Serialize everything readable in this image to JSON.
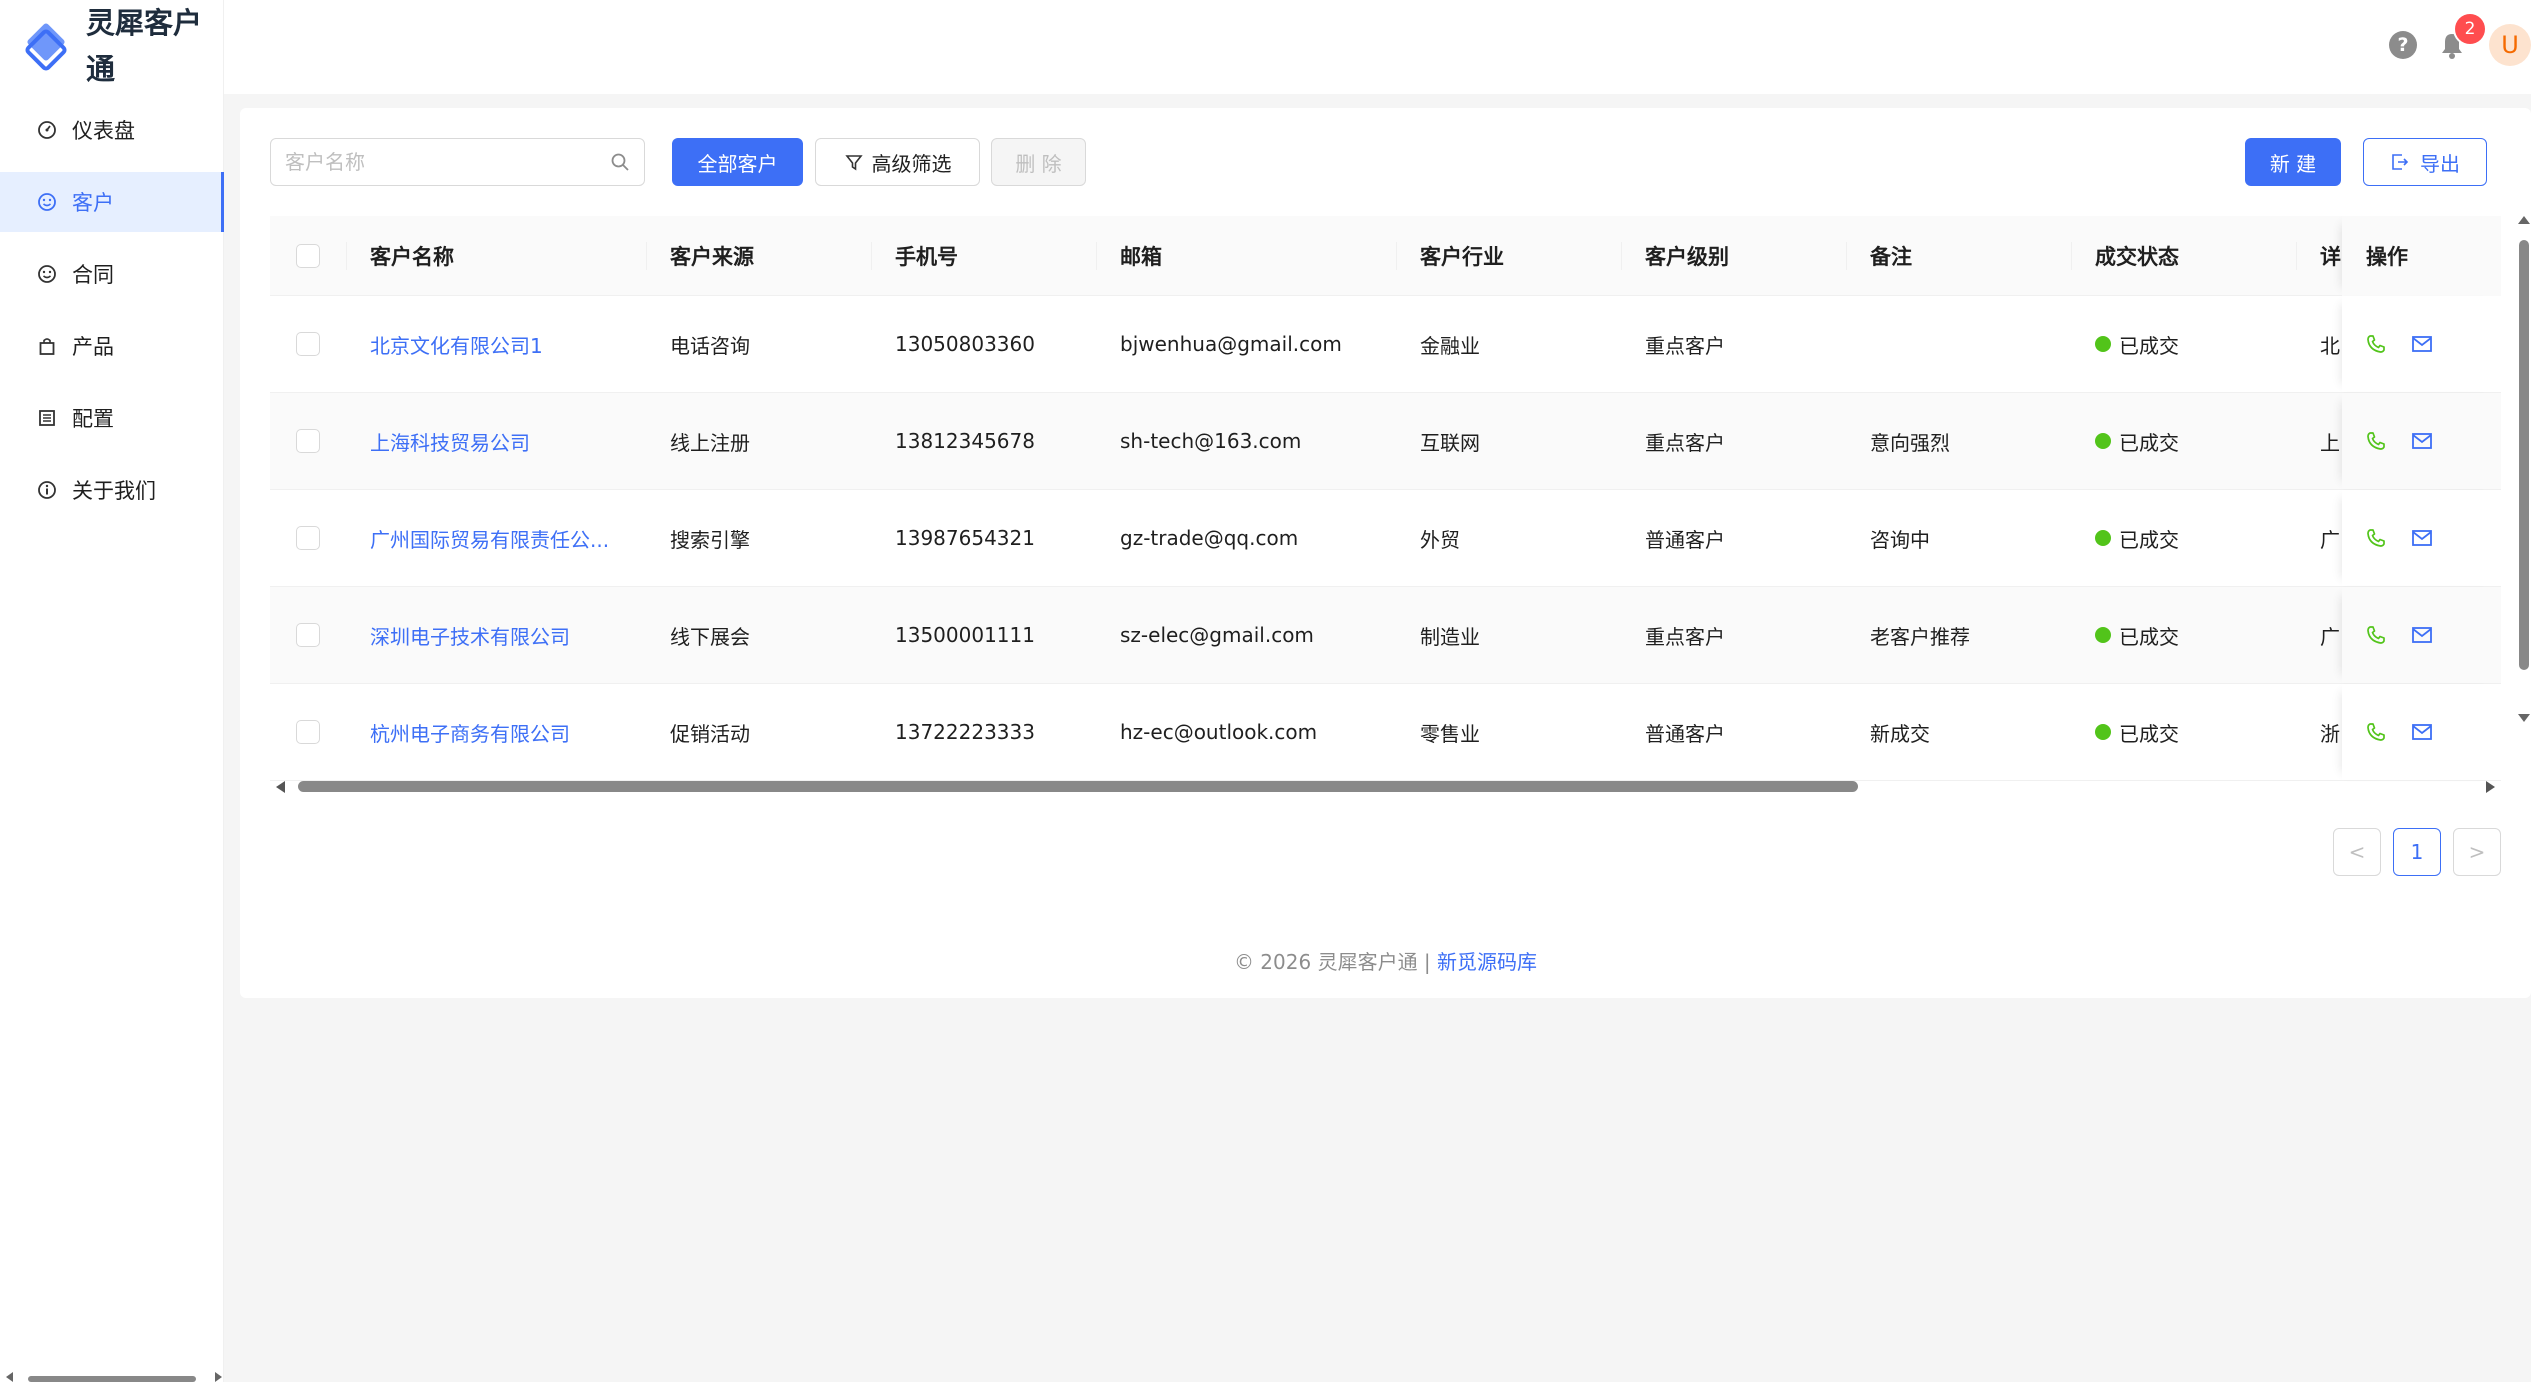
{
  "app": {
    "title": "灵犀客户通"
  },
  "sidebar": {
    "items": [
      {
        "label": "仪表盘",
        "icon": "dashboard-icon"
      },
      {
        "label": "客户",
        "icon": "smile-icon",
        "active": true
      },
      {
        "label": "合同",
        "icon": "smile-icon"
      },
      {
        "label": "产品",
        "icon": "shopping-bag-icon"
      },
      {
        "label": "配置",
        "icon": "list-icon"
      },
      {
        "label": "关于我们",
        "icon": "info-circle-icon"
      }
    ]
  },
  "header": {
    "help_glyph": "?",
    "notification_count": "2",
    "avatar_initial": "U"
  },
  "toolbar": {
    "search_placeholder": "客户名称",
    "all_customers_label": "全部客户",
    "advanced_filter_label": "高级筛选",
    "delete_label": "删 除",
    "new_label": "新 建",
    "export_label": "导出"
  },
  "table": {
    "columns": [
      "客户名称",
      "客户来源",
      "手机号",
      "邮箱",
      "客户行业",
      "客户级别",
      "备注",
      "成交状态",
      "详",
      "操作"
    ],
    "rows": [
      {
        "name": "北京文化有限公司1",
        "source": "电话咨询",
        "phone": "13050803360",
        "email": "bjwenhua@gmail.com",
        "industry": "金融业",
        "level": "重点客户",
        "note": "",
        "status": "已成交",
        "detail": "北"
      },
      {
        "name": "上海科技贸易公司",
        "source": "线上注册",
        "phone": "13812345678",
        "email": "sh-tech@163.com",
        "industry": "互联网",
        "level": "重点客户",
        "note": "意向强烈",
        "status": "已成交",
        "detail": "上"
      },
      {
        "name": "广州国际贸易有限责任公...",
        "source": "搜索引擎",
        "phone": "13987654321",
        "email": "gz-trade@qq.com",
        "industry": "外贸",
        "level": "普通客户",
        "note": "咨询中",
        "status": "已成交",
        "detail": "广"
      },
      {
        "name": "深圳电子技术有限公司",
        "source": "线下展会",
        "phone": "13500001111",
        "email": "sz-elec@gmail.com",
        "industry": "制造业",
        "level": "重点客户",
        "note": "老客户推荐",
        "status": "已成交",
        "detail": "广"
      },
      {
        "name": "杭州电子商务有限公司",
        "source": "促销活动",
        "phone": "13722223333",
        "email": "hz-ec@outlook.com",
        "industry": "零售业",
        "level": "普通客户",
        "note": "新成交",
        "status": "已成交",
        "detail": "浙"
      }
    ]
  },
  "pagination": {
    "current": "1",
    "prev_glyph": "<",
    "next_glyph": ">"
  },
  "footer": {
    "copyright": "© 2026 灵犀客户通 | ",
    "link": "新觅源码库"
  },
  "colors": {
    "primary": "#3d6ff6",
    "success": "#52c41a",
    "danger": "#ff4d4f",
    "phone_icon": "#52c41a"
  }
}
